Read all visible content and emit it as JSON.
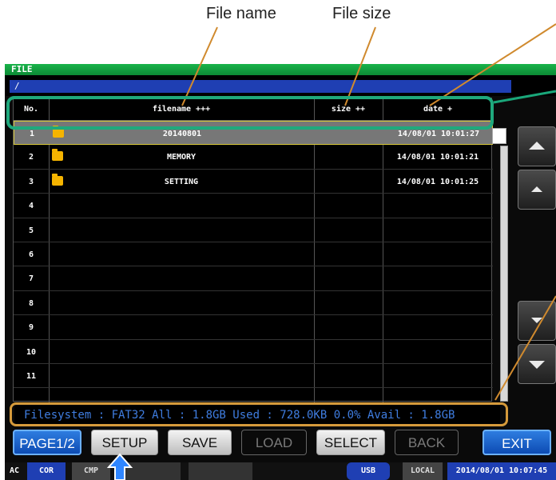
{
  "callouts": {
    "file_name": "File name",
    "file_size": "File size"
  },
  "window": {
    "title": "FILE",
    "path": "/"
  },
  "table": {
    "headers": [
      "No.",
      "filename +++",
      "size ++",
      "date +"
    ],
    "rows": [
      {
        "no": "1",
        "name": "20140801",
        "size": "",
        "date": "14/08/01 10:01:27",
        "is_folder": true
      },
      {
        "no": "2",
        "name": "MEMORY",
        "size": "",
        "date": "14/08/01 10:01:21",
        "is_folder": true
      },
      {
        "no": "3",
        "name": "SETTING",
        "size": "",
        "date": "14/08/01 10:01:25",
        "is_folder": true
      },
      {
        "no": "4",
        "name": "",
        "size": "",
        "date": "",
        "is_folder": false
      },
      {
        "no": "5",
        "name": "",
        "size": "",
        "date": "",
        "is_folder": false
      },
      {
        "no": "6",
        "name": "",
        "size": "",
        "date": "",
        "is_folder": false
      },
      {
        "no": "7",
        "name": "",
        "size": "",
        "date": "",
        "is_folder": false
      },
      {
        "no": "8",
        "name": "",
        "size": "",
        "date": "",
        "is_folder": false
      },
      {
        "no": "9",
        "name": "",
        "size": "",
        "date": "",
        "is_folder": false
      },
      {
        "no": "10",
        "name": "",
        "size": "",
        "date": "",
        "is_folder": false
      },
      {
        "no": "11",
        "name": "",
        "size": "",
        "date": "",
        "is_folder": false
      }
    ]
  },
  "status": {
    "filesystem": "Filesystem : FAT32  All : 1.8GB  Used : 728.0KB  0.0%  Avail : 1.8GB"
  },
  "buttons": {
    "page": "PAGE1/2",
    "setup": "SETUP",
    "save": "SAVE",
    "load": "LOAD",
    "select": "SELECT",
    "back": "BACK",
    "exit": "EXIT"
  },
  "bottom_bar": {
    "ac": "AC",
    "cor": "COR",
    "cmp": "CMP",
    "usb": "USB",
    "local": "LOCAL",
    "datetime": "2014/08/01 10:07:45"
  },
  "colors": {
    "accent_green": "#19b34a",
    "accent_blue": "#0d4bb3",
    "callout_orange": "#d59a3b",
    "callout_green": "#1fa97d"
  }
}
